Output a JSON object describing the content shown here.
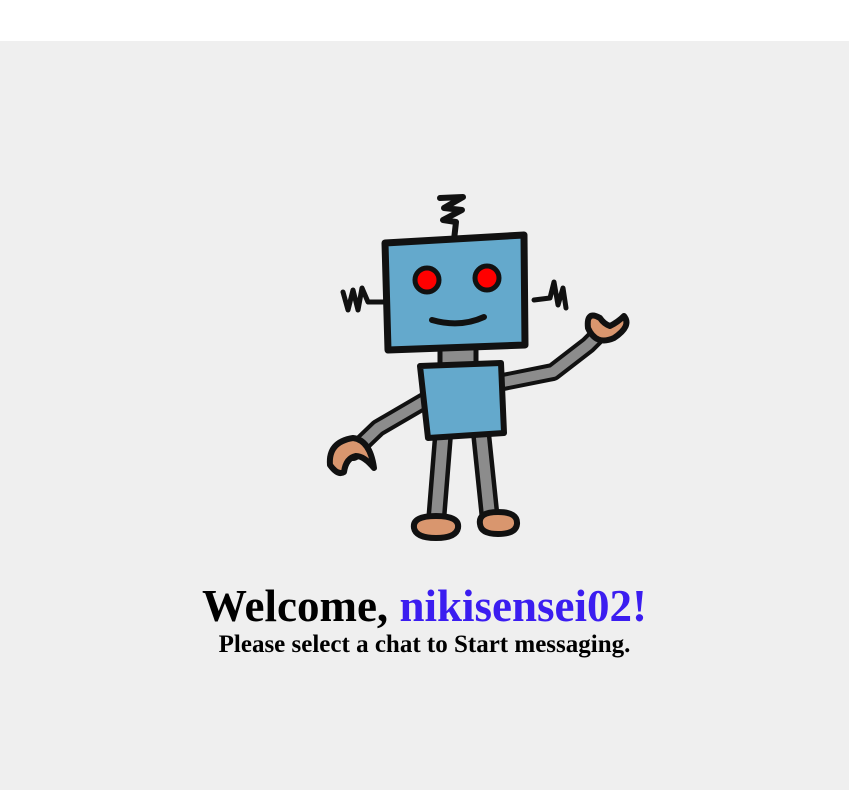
{
  "welcome": {
    "greeting": "Welcome, ",
    "username": "nikisensei02!",
    "subtitle": "Please select a chat to Start messaging."
  },
  "illustration": {
    "icon": "robot-waving-icon",
    "colors": {
      "body": "#64a9cc",
      "limbs": "#8c8c8c",
      "eyes": "#ff0000",
      "hands": "#d9966e",
      "outline": "#111111"
    }
  },
  "colors": {
    "background": "#efefef",
    "username": "#3b1df0"
  }
}
